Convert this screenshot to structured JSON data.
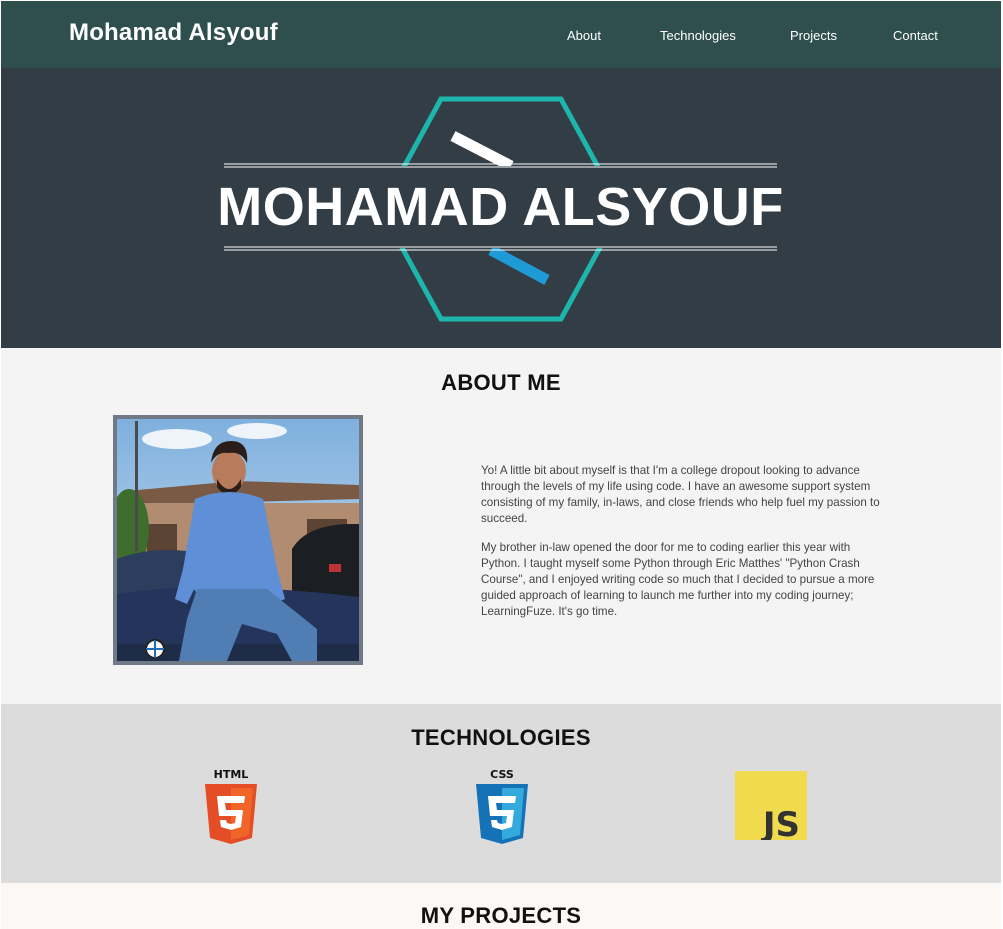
{
  "nav": {
    "brand": "Mohamad Alsyouf",
    "links": [
      "About",
      "Technologies",
      "Projects",
      "Contact"
    ]
  },
  "hero": {
    "title": "MOHAMAD ALSYOUF"
  },
  "about": {
    "title": "ABOUT ME",
    "paragraphs": [
      "Yo! A little bit about myself is that I'm a college dropout looking to advance through the levels of my life using code. I have an awesome support system consisting of my family, in-laws, and close friends who help fuel my passion to succeed.",
      "My brother in-law opened the door for me to coding earlier this year with Python. I taught myself some Python through Eric Matthes' \"Python Crash Course\", and I enjoyed writing code so much that I decided to pursue a more guided approach of learning to launch me further into my coding journey; LearningFuze. It's go time."
    ]
  },
  "technologies": {
    "title": "TECHNOLOGIES",
    "items": [
      {
        "label": "HTML",
        "icon": "html5-icon",
        "color": "#e44d26"
      },
      {
        "label": "CSS",
        "icon": "css3-icon",
        "color": "#1572b6"
      },
      {
        "label": "JS",
        "icon": "javascript-icon",
        "color": "#f0db4f"
      }
    ]
  },
  "projects": {
    "title": "MY PROJECTS"
  },
  "colors": {
    "nav_bg": "#2f4f4f",
    "hero_bg": "#333d45",
    "hexagon": "#1eb5ad",
    "accent_blue": "#1e9bd7"
  }
}
